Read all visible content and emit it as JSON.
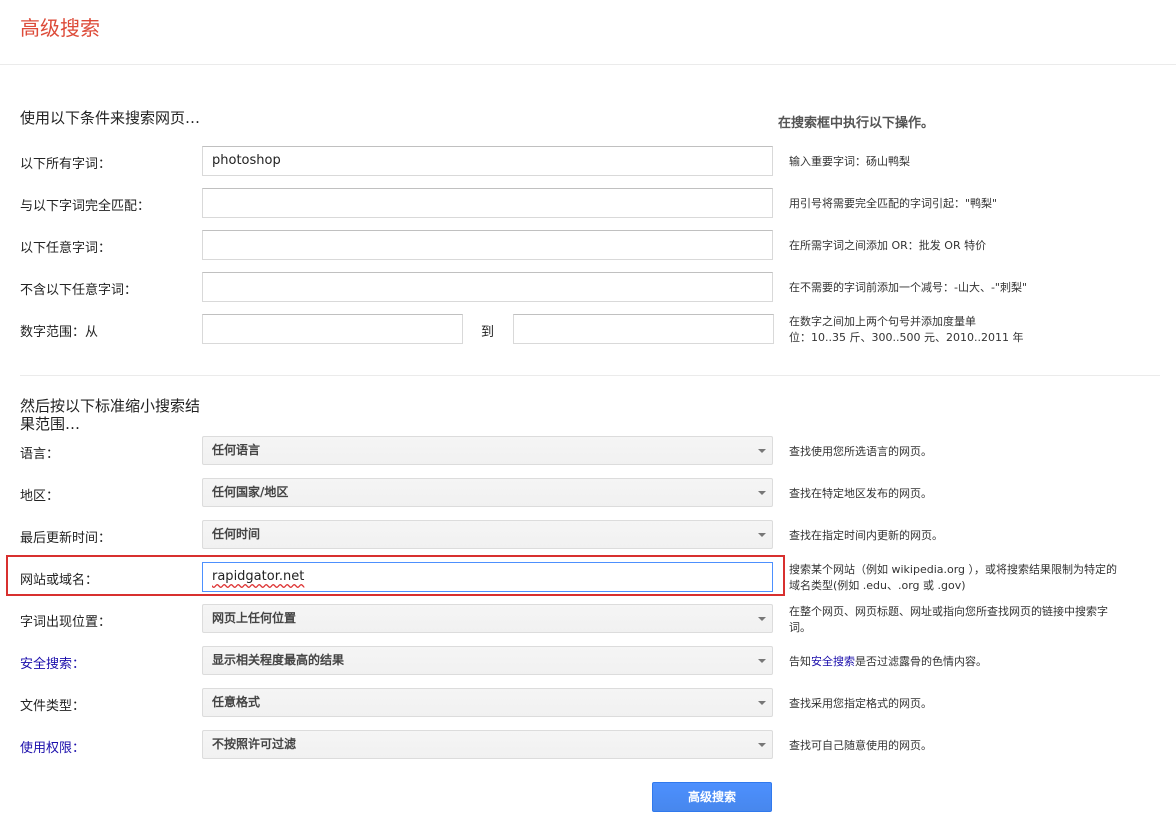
{
  "page": {
    "title": "高级搜索"
  },
  "section1": {
    "heading": "使用以下条件来搜索网页…",
    "right_heading": "在搜索框中执行以下操作。",
    "rows": [
      {
        "label": "以下所有字词：",
        "value": "photoshop",
        "hint": "输入重要字词：砀山鸭梨"
      },
      {
        "label": "与以下字词完全匹配：",
        "value": "",
        "hint": "用引号将需要完全匹配的字词引起：\"鸭梨\""
      },
      {
        "label": "以下任意字词：",
        "value": "",
        "hint": "在所需字词之间添加 OR：批发 OR 特价"
      },
      {
        "label": "不含以下任意字词：",
        "value": "",
        "hint": "在不需要的字词前添加一个减号：-山大、-\"刺梨\""
      }
    ],
    "range": {
      "label": "数字范围：从",
      "from_value": "",
      "to_label": "到",
      "to_value": "",
      "hint_line1": "在数字之间加上两个句号并添加度量单",
      "hint_line2": "位：10..35 斤、300..500 元、2010..2011 年"
    }
  },
  "section2": {
    "heading": "然后按以下标准缩小搜索结果范围…",
    "language": {
      "label": "语言：",
      "selected": "任何语言",
      "hint": "查找使用您所选语言的网页。"
    },
    "region": {
      "label": "地区：",
      "selected": "任何国家/地区",
      "hint": "查找在特定地区发布的网页。"
    },
    "last_update": {
      "label": "最后更新时间：",
      "selected": "任何时间",
      "hint": "查找在指定时间内更新的网页。"
    },
    "site": {
      "label": "网站或域名：",
      "value": "rapidgator.net",
      "hint_line1": "搜索某个网站（例如 wikipedia.org ），或将搜索结果限制为特定的",
      "hint_line2": "域名类型(例如 .edu、.org 或 .gov)"
    },
    "terms_appear": {
      "label": "字词出现位置：",
      "selected": "网页上任何位置",
      "hint_line1": "在整个网页、网页标题、网址或指向您所查找网页的链接中搜索字",
      "hint_line2": "词。"
    },
    "safesearch": {
      "label": "安全搜索：",
      "selected": "显示相关程度最高的结果",
      "hint_pre": "告知",
      "hint_link": "安全搜索",
      "hint_post": "是否过滤露骨的色情内容。"
    },
    "file_type": {
      "label": "文件类型：",
      "selected": "任意格式",
      "hint": "查找采用您指定格式的网页。"
    },
    "usage_rights": {
      "label": "使用权限：",
      "selected": "不按照许可过滤",
      "hint": "查找可自己随意使用的网页。"
    }
  },
  "submit_label": "高级搜索",
  "colors": {
    "accent_red": "#dd4b39",
    "link_blue": "#1a0dab",
    "button_blue": "#4d90fe",
    "highlight_red": "#d8302f"
  }
}
